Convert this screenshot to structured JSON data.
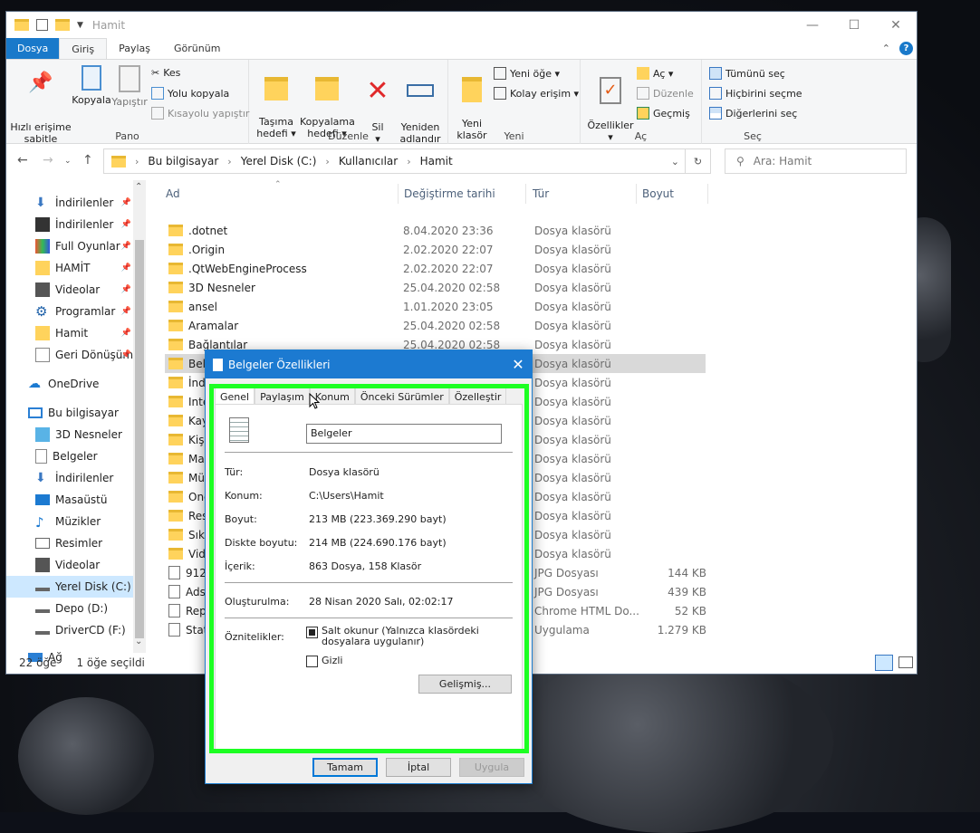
{
  "window": {
    "title": "Hamit"
  },
  "tabs": {
    "file": "Dosya",
    "home": "Giriş",
    "share": "Paylaş",
    "view": "Görünüm"
  },
  "ribbon": {
    "pin": "Hızlı erişime\nsabitle",
    "copy": "Kopyala",
    "paste": "Yapıştır",
    "cut": "Kes",
    "copy_path": "Yolu kopyala",
    "paste_shortcut": "Kısayolu yapıştır",
    "group_clipboard": "Pano",
    "move_to": "Taşıma\nhedefi ▾",
    "copy_to": "Kopyalama\nhedefi ▾",
    "delete": "Sil\n▾",
    "rename": "Yeniden\nadlandır",
    "group_organize": "Düzenle",
    "new_folder": "Yeni\nklasör",
    "new_item": "Yeni öğe ▾",
    "easy_access": "Kolay erişim ▾",
    "group_new": "Yeni",
    "properties": "Özellikler\n▾",
    "open": "Aç ▾",
    "edit": "Düzenle",
    "history": "Geçmiş",
    "group_open": "Aç",
    "select_all": "Tümünü seç",
    "select_none": "Hiçbirini seçme",
    "invert": "Diğerlerini seç",
    "group_select": "Seç"
  },
  "address": {
    "crumbs": [
      "Bu bilgisayar",
      "Yerel Disk (C:)",
      "Kullanıcılar",
      "Hamit"
    ],
    "search_placeholder": "Ara: Hamit"
  },
  "nav": [
    {
      "label": "İndirilenler",
      "icon": "download-icon",
      "pin": true
    },
    {
      "label": "İndirilenler",
      "icon": "clapper-icon",
      "pin": true
    },
    {
      "label": "Full Oyunlar",
      "icon": "games-icon",
      "pin": true
    },
    {
      "label": "HAMİT",
      "icon": "folder-icon",
      "pin": true
    },
    {
      "label": "Videolar",
      "icon": "video-icon",
      "pin": true
    },
    {
      "label": "Programlar",
      "icon": "gear-icon",
      "pin": true
    },
    {
      "label": "Hamit",
      "icon": "folder-icon",
      "pin": true
    },
    {
      "label": "Geri Dönüşüm",
      "icon": "recycle-icon",
      "pin": true
    },
    {
      "label": "OneDrive",
      "icon": "cloud-icon"
    },
    {
      "label": "Bu bilgisayar",
      "icon": "computer-icon"
    },
    {
      "label": "3D Nesneler",
      "icon": "cube-icon"
    },
    {
      "label": "Belgeler",
      "icon": "document-icon"
    },
    {
      "label": "İndirilenler",
      "icon": "download-icon"
    },
    {
      "label": "Masaüstü",
      "icon": "desktop-icon"
    },
    {
      "label": "Müzikler",
      "icon": "music-icon"
    },
    {
      "label": "Resimler",
      "icon": "picture-icon"
    },
    {
      "label": "Videolar",
      "icon": "video-icon"
    },
    {
      "label": "Yerel Disk (C:)",
      "icon": "drive-icon"
    },
    {
      "label": "Depo (D:)",
      "icon": "drive-icon"
    },
    {
      "label": "DriverCD (F:)",
      "icon": "drive-icon"
    },
    {
      "label": "Ağ",
      "icon": "network-icon"
    }
  ],
  "columns": [
    "Ad",
    "Değiştirme tarihi",
    "Tür",
    "Boyut"
  ],
  "files": [
    {
      "name": ".dotnet",
      "date": "8.04.2020 23:36",
      "type": "Dosya klasörü",
      "size": ""
    },
    {
      "name": ".Origin",
      "date": "2.02.2020 22:07",
      "type": "Dosya klasörü",
      "size": ""
    },
    {
      "name": ".QtWebEngineProcess",
      "date": "2.02.2020 22:07",
      "type": "Dosya klasörü",
      "size": ""
    },
    {
      "name": "3D Nesneler",
      "date": "25.04.2020 02:58",
      "type": "Dosya klasörü",
      "size": ""
    },
    {
      "name": "ansel",
      "date": "1.01.2020 23:05",
      "type": "Dosya klasörü",
      "size": ""
    },
    {
      "name": "Aramalar",
      "date": "25.04.2020 02:58",
      "type": "Dosya klasörü",
      "size": ""
    },
    {
      "name": "Bağlantılar",
      "date": "25.04.2020 02:58",
      "type": "Dosya klasörü",
      "size": ""
    },
    {
      "name": "Belgeler",
      "date": "",
      "type": "Dosya klasörü",
      "size": ""
    },
    {
      "name": "İndi",
      "date": "",
      "type": "Dosya klasörü",
      "size": ""
    },
    {
      "name": "Inte",
      "date": "",
      "type": "Dosya klasörü",
      "size": ""
    },
    {
      "name": "Kayı",
      "date": "",
      "type": "Dosya klasörü",
      "size": ""
    },
    {
      "name": "Kişil",
      "date": "",
      "type": "Dosya klasörü",
      "size": ""
    },
    {
      "name": "Mas",
      "date": "",
      "type": "Dosya klasörü",
      "size": ""
    },
    {
      "name": "Müz",
      "date": "",
      "type": "Dosya klasörü",
      "size": ""
    },
    {
      "name": "One",
      "date": "",
      "type": "Dosya klasörü",
      "size": ""
    },
    {
      "name": "Resi",
      "date": "",
      "type": "Dosya klasörü",
      "size": ""
    },
    {
      "name": "Sık K",
      "date": "",
      "type": "Dosya klasörü",
      "size": ""
    },
    {
      "name": "Vide",
      "date": "",
      "type": "Dosya klasörü",
      "size": ""
    },
    {
      "name": "912",
      "date": "",
      "type": "JPG Dosyası",
      "size": "144 KB"
    },
    {
      "name": "Ads",
      "date": "",
      "type": "JPG Dosyası",
      "size": "439 KB"
    },
    {
      "name": "Rep",
      "date": "",
      "type": "Chrome HTML Do...",
      "size": "52 KB"
    },
    {
      "name": "Stat",
      "date": "",
      "type": "Uygulama",
      "size": "1.279 KB"
    }
  ],
  "status": {
    "count": "22 öğe",
    "selected": "1 öğe seçildi"
  },
  "dialog": {
    "title": "Belgeler Özellikleri",
    "tabs": [
      "Genel",
      "Paylaşım",
      "Konum",
      "Önceki Sürümler",
      "Özelleştir"
    ],
    "name": "Belgeler",
    "rows": [
      {
        "label": "Tür:",
        "value": "Dosya klasörü"
      },
      {
        "label": "Konum:",
        "value": "C:\\Users\\Hamit"
      },
      {
        "label": "Boyut:",
        "value": "213 MB (223.369.290 bayt)"
      },
      {
        "label": "Diskte boyutu:",
        "value": "214 MB (224.690.176 bayt)"
      },
      {
        "label": "İçerik:",
        "value": "863 Dosya, 158 Klasör"
      }
    ],
    "created_label": "Oluşturulma:",
    "created_value": "28 Nisan 2020 Salı, 02:02:17",
    "attr_label": "Öznitelikler:",
    "readonly": "Salt okunur (Yalnızca klasördeki dosyalara uygulanır)",
    "hidden": "Gizli",
    "advanced": "Gelişmiş...",
    "ok": "Tamam",
    "cancel": "İptal",
    "apply": "Uygula"
  }
}
